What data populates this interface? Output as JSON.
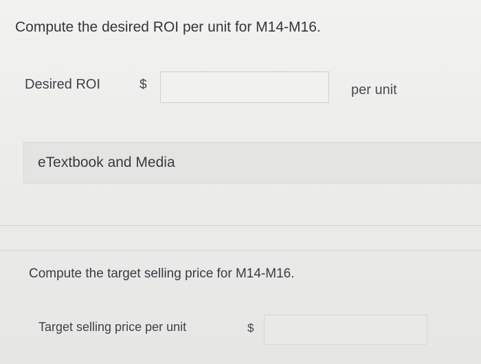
{
  "question1": {
    "prompt": "Compute the desired ROI per unit for M14-M16.",
    "field_label": "Desired ROI",
    "currency_symbol": "$",
    "input_value": "",
    "unit_suffix": "per unit"
  },
  "etextbook_button": {
    "label": "eTextbook and Media"
  },
  "question2": {
    "prompt": "Compute the target selling price for M14-M16.",
    "field_label": "Target selling price per unit",
    "currency_symbol": "$",
    "input_value": ""
  }
}
